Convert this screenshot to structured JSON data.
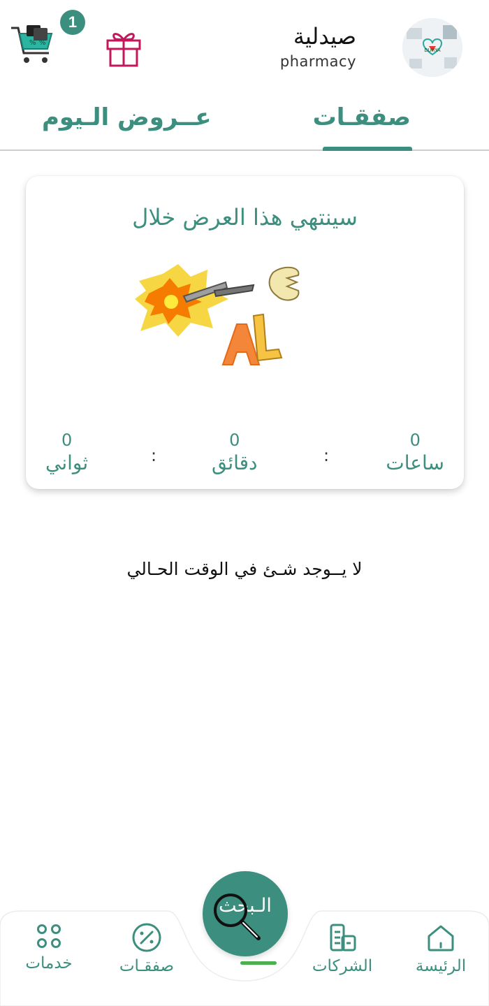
{
  "header": {
    "store_name": "صيدلية",
    "store_subtitle": "pharmacy",
    "cart_count": "1",
    "icons": [
      "shopping-cart-icon",
      "gift-icon"
    ],
    "avatar_alt": "DURYA"
  },
  "tabs": [
    {
      "label": "عــروض الـيوم",
      "active": false
    },
    {
      "label": "صفقـات",
      "active": true
    }
  ],
  "offer_card": {
    "title": "سينتهي هذا العرض خلال",
    "art_icon": "sale-explosion-image",
    "countdown": {
      "hours_value": "0",
      "hours_label": "ساعات",
      "minutes_value": "0",
      "minutes_label": "دقائق",
      "seconds_value": "0",
      "seconds_label": "ثواني",
      "separator": ":"
    }
  },
  "empty_message": "لا يــوجد شـئ في الوقت الحـالي",
  "bottom_nav": {
    "items": [
      {
        "label": "خدمات",
        "icon": "grid-dots-icon"
      },
      {
        "label": "صفقـات",
        "icon": "percent-icon"
      },
      {
        "label": "الشركات",
        "icon": "buildings-icon"
      },
      {
        "label": "الرئيسة",
        "icon": "home-icon"
      }
    ],
    "search_label": "الـبحث",
    "search_icon": "magnifier-icon"
  },
  "colors": {
    "primary": "#3c8f7e",
    "badge": "#3c8f7e",
    "gift": "#c2185b",
    "active_line": "#4caf50"
  }
}
